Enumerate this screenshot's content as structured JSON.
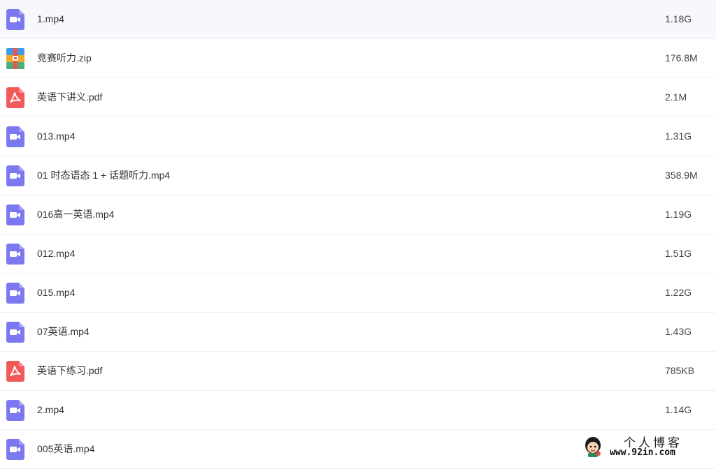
{
  "files": [
    {
      "name": "1.mp4",
      "size": "1.18G",
      "type": "video",
      "icon": "video-file-icon"
    },
    {
      "name": "竞赛听力.zip",
      "size": "176.8M",
      "type": "zip",
      "icon": "zip-file-icon"
    },
    {
      "name": "英语下讲义.pdf",
      "size": "2.1M",
      "type": "pdf",
      "icon": "pdf-file-icon"
    },
    {
      "name": "013.mp4",
      "size": "1.31G",
      "type": "video",
      "icon": "video-file-icon"
    },
    {
      "name": "01 时态语态 1 + 话题听力.mp4",
      "size": "358.9M",
      "type": "video",
      "icon": "video-file-icon"
    },
    {
      "name": "016高一英语.mp4",
      "size": "1.19G",
      "type": "video",
      "icon": "video-file-icon"
    },
    {
      "name": "012.mp4",
      "size": "1.51G",
      "type": "video",
      "icon": "video-file-icon"
    },
    {
      "name": "015.mp4",
      "size": "1.22G",
      "type": "video",
      "icon": "video-file-icon"
    },
    {
      "name": "07英语.mp4",
      "size": "1.43G",
      "type": "video",
      "icon": "video-file-icon"
    },
    {
      "name": "英语下练习.pdf",
      "size": "785KB",
      "type": "pdf",
      "icon": "pdf-file-icon"
    },
    {
      "name": "2.mp4",
      "size": "1.14G",
      "type": "video",
      "icon": "video-file-icon"
    },
    {
      "name": "005英语.mp4",
      "size": "",
      "type": "video",
      "icon": "video-file-icon"
    }
  ],
  "watermark": {
    "title": "个人博客",
    "url": "www.92in.com"
  },
  "colors": {
    "video": "#7b78f0",
    "pdf": "#f25a5a",
    "zip_top": "#f5a623",
    "zip_mid": "#e8574a",
    "zip_bottom": "#4cae7a",
    "zip_left": "#3d9be9",
    "text": "#333333",
    "divider": "#f0f0f2"
  }
}
